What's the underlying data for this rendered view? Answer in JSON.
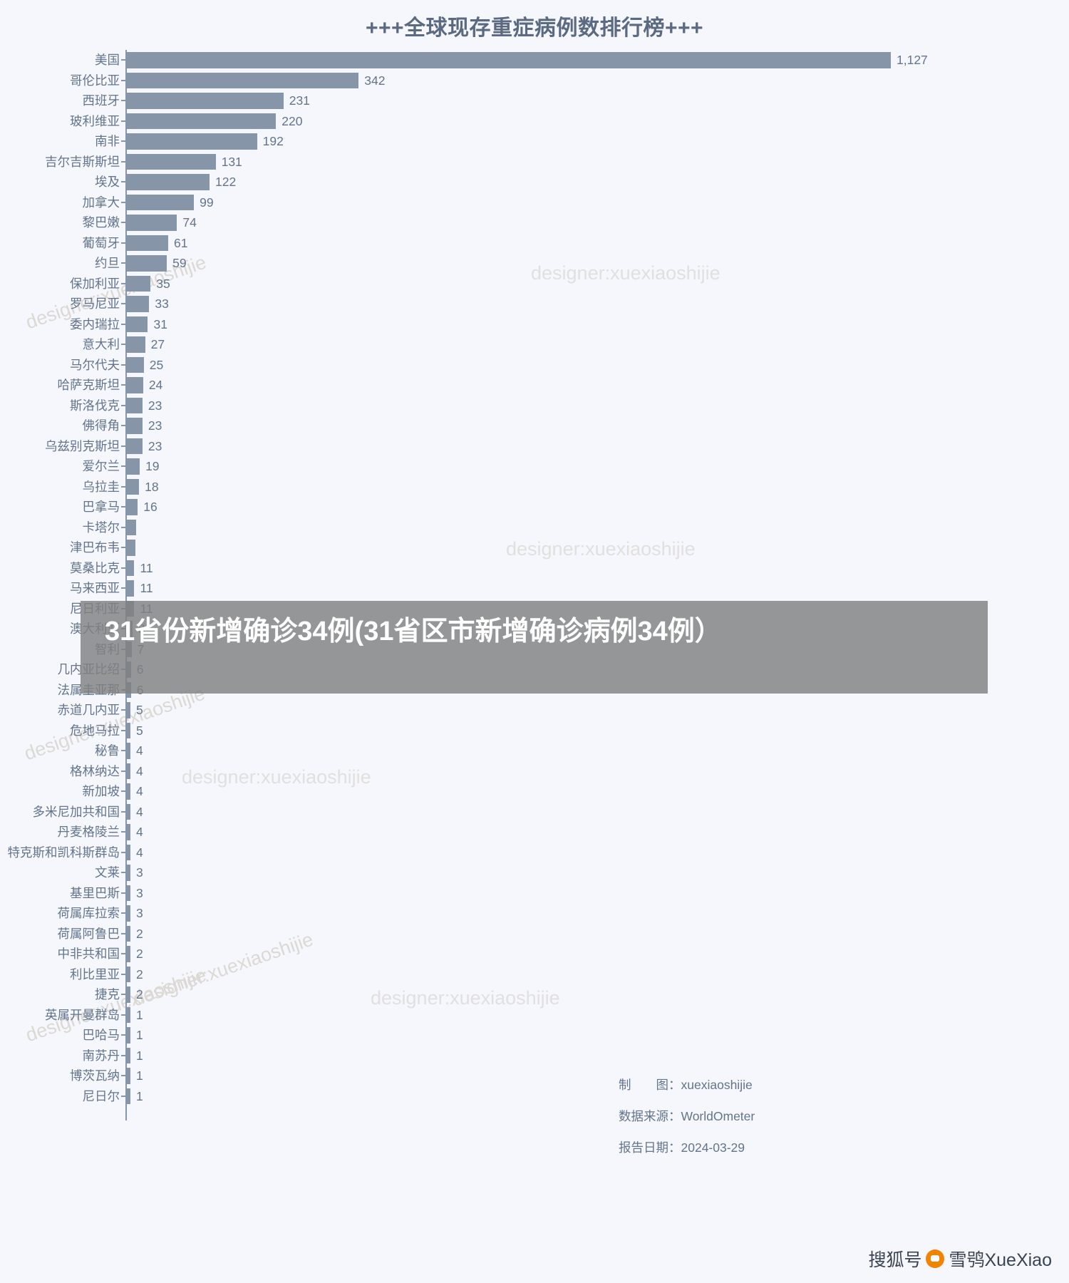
{
  "chart_data": {
    "type": "bar",
    "orientation": "horizontal",
    "title": "+++全球现存重症病例数排行榜+++",
    "xlabel": "",
    "ylabel": "",
    "grid": false,
    "legend": null,
    "xlim": [
      0,
      1127
    ],
    "bar_color": "#8795a8",
    "categories": [
      "美国",
      "哥伦比亚",
      "西班牙",
      "玻利维亚",
      "南非",
      "吉尔吉斯斯坦",
      "埃及",
      "加拿大",
      "黎巴嫩",
      "葡萄牙",
      "约旦",
      "保加利亚",
      "罗马尼亚",
      "委内瑞拉",
      "意大利",
      "马尔代夫",
      "哈萨克斯坦",
      "斯洛伐克",
      "佛得角",
      "乌兹别克斯坦",
      "爱尔兰",
      "乌拉圭",
      "巴拿马",
      "卡塔尔",
      "津巴布韦",
      "莫桑比克",
      "马来西亚",
      "尼日利亚",
      "澳大利亚",
      "智利",
      "几内亚比绍",
      "法属圭亚那",
      "赤道几内亚",
      "危地马拉",
      "秘鲁",
      "格林纳达",
      "新加坡",
      "多米尼加共和国",
      "丹麦格陵兰",
      "特克斯和凯科斯群岛",
      "文莱",
      "基里巴斯",
      "荷属库拉索",
      "荷属阿鲁巴",
      "中非共和国",
      "利比里亚",
      "捷克",
      "英属开曼群岛",
      "巴哈马",
      "南苏丹",
      "博茨瓦纳",
      "尼日尔"
    ],
    "values": [
      1127,
      342,
      231,
      220,
      192,
      131,
      122,
      99,
      74,
      61,
      59,
      35,
      33,
      31,
      27,
      25,
      24,
      23,
      23,
      23,
      19,
      18,
      16,
      14,
      13,
      11,
      11,
      11,
      8,
      7,
      6,
      6,
      5,
      5,
      4,
      4,
      4,
      4,
      4,
      4,
      3,
      3,
      3,
      2,
      2,
      2,
      2,
      1,
      1,
      1,
      1,
      1
    ],
    "value_labels": [
      "1,127",
      "342",
      "231",
      "220",
      "192",
      "131",
      "122",
      "99",
      "74",
      "61",
      "59",
      "35",
      "33",
      "31",
      "27",
      "25",
      "24",
      "23",
      "23",
      "23",
      "19",
      "18",
      "16",
      "",
      "",
      "11",
      "11",
      "11",
      "8",
      "7",
      "6",
      "6",
      "5",
      "5",
      "4",
      "4",
      "4",
      "4",
      "4",
      "4",
      "3",
      "3",
      "3",
      "2",
      "2",
      "2",
      "2",
      "1",
      "1",
      "1",
      "1",
      "1"
    ]
  },
  "footer": {
    "credit_key": "制　　图：",
    "credit_value": "xuexiaoshijie",
    "source_key": "数据来源：",
    "source_value": "WorldOmeter",
    "date_key": "报告日期：",
    "date_value": "2024-03-29"
  },
  "watermarks": {
    "text": "designer:xuexiaoshijie"
  },
  "overlay": {
    "headline": "31省份新增确诊34例(31省区市新增确诊病例34例）"
  },
  "branding": {
    "platform": "搜狐号",
    "separator": "@",
    "account": "雪鸮XueXiao"
  }
}
